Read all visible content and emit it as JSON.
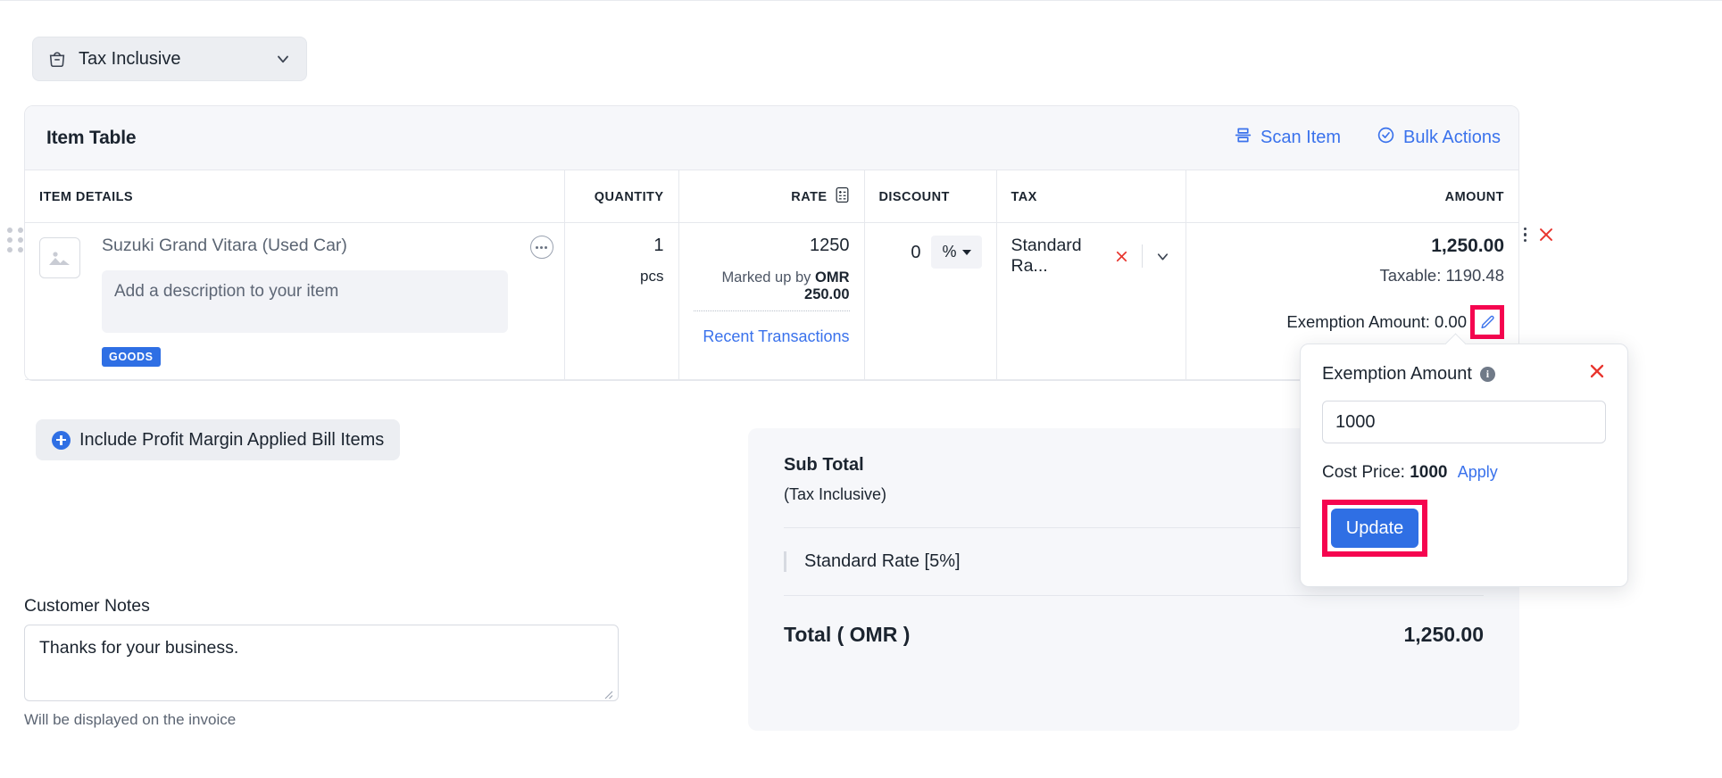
{
  "tax_mode_select": {
    "label": "Tax Inclusive",
    "icon": "bag-icon",
    "chevron": "chevron-down-icon"
  },
  "item_card": {
    "title": "Item Table",
    "actions": [
      {
        "label": "Scan Item",
        "icon": "scan-item-icon"
      },
      {
        "label": "Bulk Actions",
        "icon": "check-circle-icon"
      }
    ],
    "columns": {
      "item_details": "ITEM DETAILS",
      "quantity": "QUANTITY",
      "rate": "RATE",
      "discount": "DISCOUNT",
      "tax": "TAX",
      "amount": "AMOUNT"
    },
    "row": {
      "name": "Suzuki Grand Vitara (Used Car)",
      "description_placeholder": "Add a description to your item",
      "badge": "GOODS",
      "quantity": "1",
      "unit": "pcs",
      "rate": "1250",
      "markup_prefix": "Marked up by",
      "markup_value": "OMR 250.00",
      "recent_transactions": "Recent Transactions",
      "discount": "0",
      "discount_unit": "%",
      "tax": "Standard Ra...",
      "amount": "1,250.00",
      "taxable": "Taxable: 1190.48",
      "exemption": "Exemption Amount: 0.00"
    }
  },
  "include_profit_margin_button": "Include Profit Margin Applied Bill Items",
  "totals": {
    "sub_total_label": "Sub Total",
    "sub_total_note": "(Tax Inclusive)",
    "sub_total_value": "",
    "tax_label": "Standard Rate [5%]",
    "tax_value": "",
    "grand_total_label": "Total ( OMR )",
    "grand_total_value": "1,250.00"
  },
  "customer_notes": {
    "label": "Customer Notes",
    "value": "Thanks for your business.",
    "hint": "Will be displayed on the invoice"
  },
  "exemption_popover": {
    "title": "Exemption Amount",
    "input_value": "1000",
    "cost_price_label": "Cost Price:",
    "cost_price_value": "1000",
    "apply_link": "Apply",
    "update_button": "Update"
  },
  "colors": {
    "accent_blue": "#2f6fe4",
    "link_blue": "#3a72ec",
    "danger_red": "#e8352e",
    "highlight_pink": "#f5054f",
    "panel_bg": "#f6f7fa"
  }
}
